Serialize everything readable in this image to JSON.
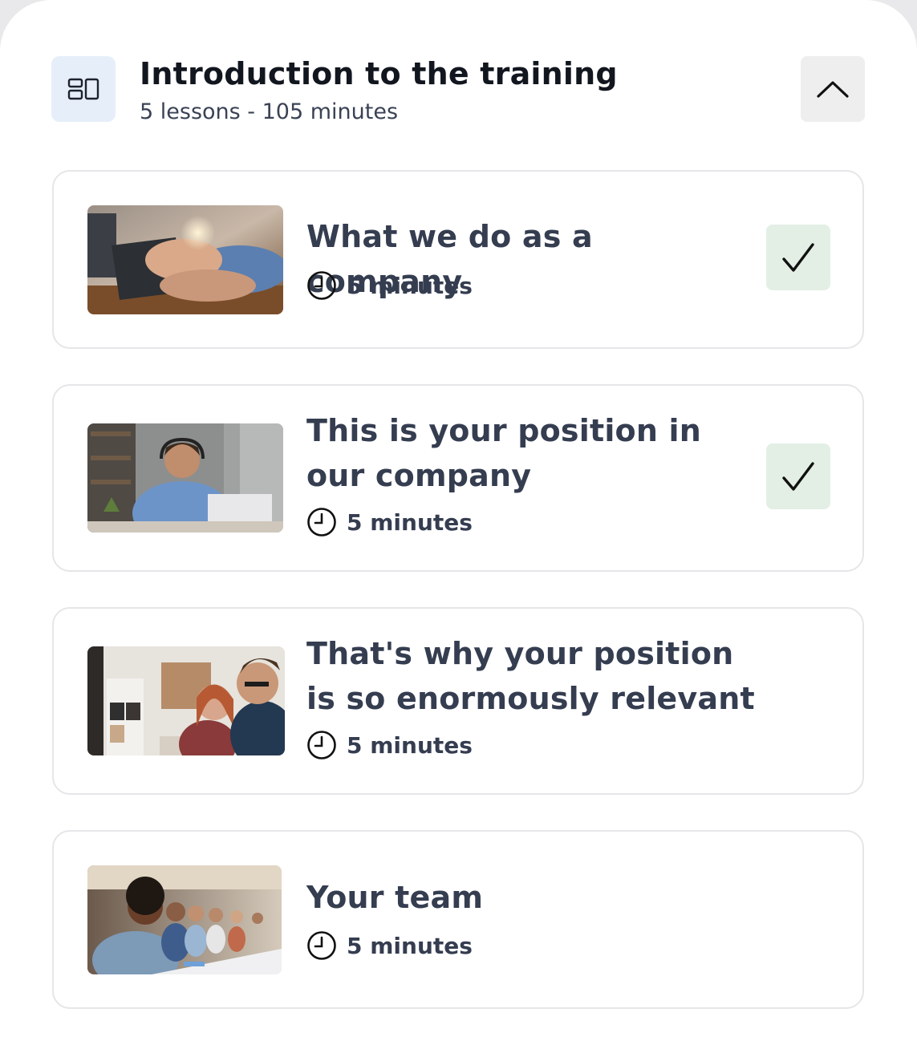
{
  "module": {
    "icon": "layout-icon",
    "title": "Introduction to the training",
    "meta": "5 lessons - 105 minutes",
    "collapse_icon": "chevron-up-icon"
  },
  "lessons": [
    {
      "title": "What we do as a company",
      "duration": "5 minutes",
      "completed": true,
      "thumbnail": "hands-typing-laptop-lightbulb"
    },
    {
      "title": "This is your position in our company",
      "duration": "5 minutes",
      "completed": true,
      "thumbnail": "man-headset-laptop"
    },
    {
      "title": "That's why your position is so enormously relevant",
      "duration": "5 minutes",
      "completed": false,
      "thumbnail": "woman-and-man-office"
    },
    {
      "title": "Your team",
      "duration": "5 minutes",
      "completed": false,
      "thumbnail": "team-meeting-table"
    }
  ],
  "colors": {
    "check_bg": "#e3efe5",
    "icon_bg": "#e6eff9",
    "collapse_bg": "#eeeeef",
    "text": "#353d50"
  }
}
